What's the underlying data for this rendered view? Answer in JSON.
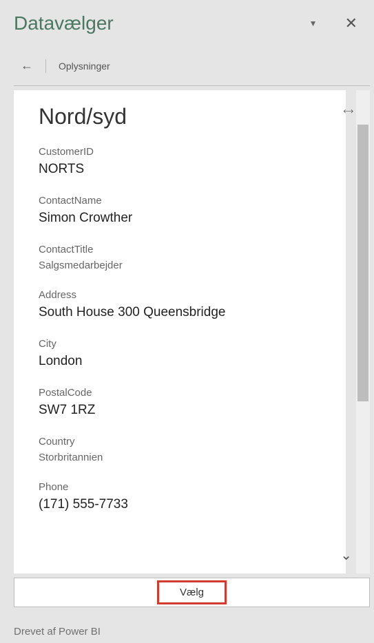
{
  "header": {
    "title": "Datavælger"
  },
  "breadcrumb": {
    "text": "Oplysninger"
  },
  "detail": {
    "title": "Nord/syd",
    "fields": {
      "customerId": {
        "label": "CustomerID",
        "value": "NORTS"
      },
      "contactName": {
        "label": "ContactName",
        "value": "Simon Crowther"
      },
      "contactTitle": {
        "label": "ContactTitle",
        "value": "Salgsmedarbejder"
      },
      "address": {
        "label": "Address",
        "value": "South House 300 Queensbridge"
      },
      "city": {
        "label": "City",
        "value": "London"
      },
      "postalCode": {
        "label": "PostalCode",
        "value": "SW7 1RZ"
      },
      "country": {
        "label": "Country",
        "value": "Storbritannien"
      },
      "phone": {
        "label": "Phone",
        "value": "(171) 555-7733"
      }
    }
  },
  "actions": {
    "select": "Vælg"
  },
  "footer": {
    "powered": "Drevet af Power BI"
  }
}
